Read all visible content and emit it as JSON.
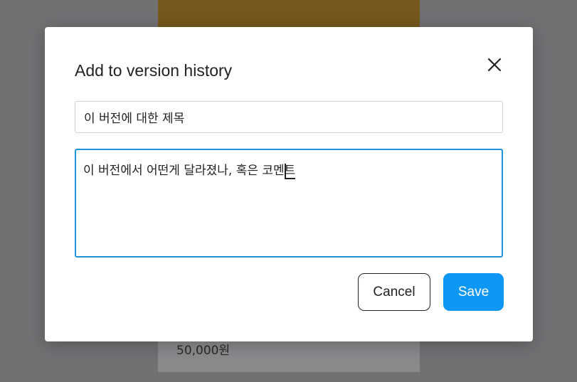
{
  "background": {
    "price": "50,000원"
  },
  "dialog": {
    "title": "Add to version history",
    "close_icon": "close-icon",
    "title_field": {
      "value": "이 버전에 대한 제목"
    },
    "comment_field": {
      "value_before_caret": "이 버전에서 어떤게 달라졌나, 혹은 코멘",
      "value_at_caret": "트"
    },
    "cancel_label": "Cancel",
    "save_label": "Save"
  },
  "colors": {
    "accent": "#0f97f5",
    "focus_border": "#1f94dc",
    "overlay": "#717073"
  }
}
